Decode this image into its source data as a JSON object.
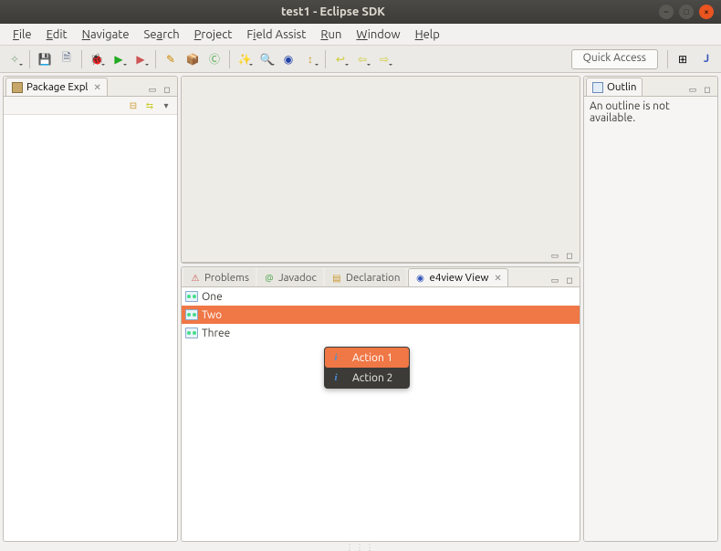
{
  "window": {
    "title": "test1 - Eclipse SDK"
  },
  "menu": {
    "file": "File",
    "edit": "Edit",
    "navigate": "Navigate",
    "search": "Search",
    "project": "Project",
    "field_assist": "Field Assist",
    "run": "Run",
    "window": "Window",
    "help": "Help"
  },
  "toolbar": {
    "quick_access": "Quick Access"
  },
  "views": {
    "package_explorer": {
      "title": "Package Expl"
    },
    "outline": {
      "title": "Outlin",
      "empty_text": "An outline is not available."
    },
    "problems": {
      "title": "Problems"
    },
    "javadoc": {
      "title": "Javadoc"
    },
    "declaration": {
      "title": "Declaration"
    },
    "e4view": {
      "title": "e4view View",
      "items": [
        {
          "label": "One",
          "selected": false
        },
        {
          "label": "Two",
          "selected": true
        },
        {
          "label": "Three",
          "selected": false
        }
      ]
    }
  },
  "context_menu": {
    "items": [
      {
        "label": "Action 1",
        "hover": true
      },
      {
        "label": "Action 2",
        "hover": false
      }
    ]
  }
}
